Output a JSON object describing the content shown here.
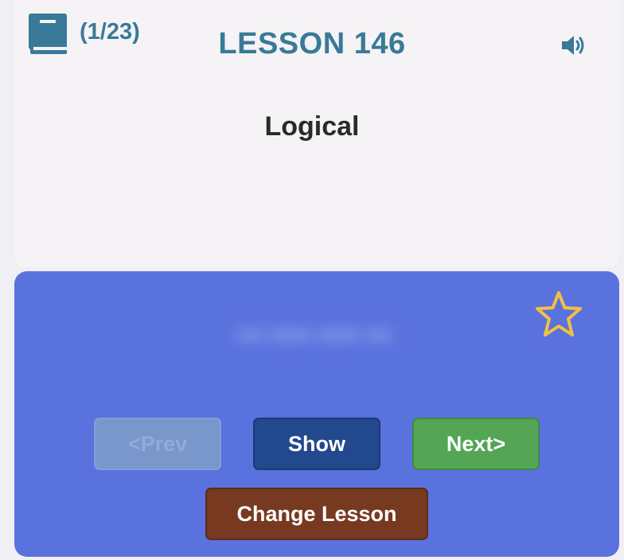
{
  "header": {
    "progress": "(1/23)",
    "lesson_title": "LESSON 146"
  },
  "card": {
    "word": "Logical",
    "hidden_answer": "••• ••••• ••••• •••"
  },
  "buttons": {
    "prev": "<Prev",
    "show": "Show",
    "next": "Next>",
    "change_lesson": "Change Lesson"
  },
  "icons": {
    "book": "book-icon",
    "speaker": "speaker-icon",
    "star": "star-outline-icon"
  },
  "colors": {
    "title": "#387a98",
    "card_background": "#5a72de",
    "star": "#f2c043",
    "show_button": "#22488d",
    "next_button": "#54a555",
    "change_button": "#783921",
    "prev_button_disabled": "#7a97cc"
  }
}
